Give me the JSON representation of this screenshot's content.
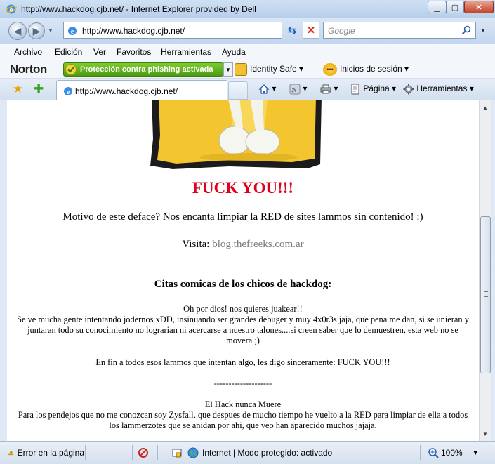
{
  "window": {
    "title": "http://www.hackdog.cjb.net/ - Internet Explorer provided by Dell"
  },
  "address": {
    "url": "http://www.hackdog.cjb.net/",
    "search_placeholder": "Google"
  },
  "menu": [
    "Archivo",
    "Edición",
    "Ver",
    "Favoritos",
    "Herramientas",
    "Ayuda"
  ],
  "norton": {
    "logo": "Norton",
    "phishing": "Protección contra phishing activada",
    "identity": "Identity Safe",
    "logins": "Inicios de sesión"
  },
  "tab": {
    "title": "http://www.hackdog.cjb.net/"
  },
  "commands": {
    "page": "Página",
    "tools": "Herramientas"
  },
  "page": {
    "headline": "FUCK YOU!!!",
    "motivo": "Motivo de este deface? Nos encanta limpiar la RED de sites lammos sin contenido! :)",
    "visita_label": "Visita: ",
    "visita_link": "blog.thefreeks.com.ar",
    "citas_heading": "Citas comicas de los chicos de hackdog:",
    "p1": "Oh por dios! nos quieres juakear!!\nSe ve mucha gente intentando jodernos xDD, insinuando ser grandes debuger y muy 4x0r3s jaja, que pena me dan, si se unieran y juntaran todo su conocimiento no lograrian ni acercarse a nuestro talones....si creen saber que lo demuestren, esta web no se movera ;)",
    "p2": "En fin a todos esos lammos que intentan algo, les digo sinceramente: FUCK YOU!!!",
    "p3": "--------------------",
    "p4": "El Hack nunca Muere\nPara los pendejos que no me conozcan soy Zysfall, que despues de mucho tiempo he vuelto a la RED para limpiar de ella a todos los lammerzotes que se anidan por ahi, que veo han aparecido muchos jajaja."
  },
  "status": {
    "error": "Error en la página",
    "zone": "Internet | Modo protegido: activado",
    "zoom": "100%"
  },
  "icons": [
    "ie-icon",
    "back-icon",
    "forward-icon",
    "page-icon",
    "refresh-icon",
    "stop-icon",
    "search-icon",
    "check-icon",
    "lock-icon",
    "star-icon",
    "add-favorite-icon",
    "home-icon",
    "feeds-icon",
    "print-icon",
    "page-menu-icon",
    "tools-gear-icon",
    "warning-icon",
    "globe-icon",
    "zoom-icon"
  ]
}
